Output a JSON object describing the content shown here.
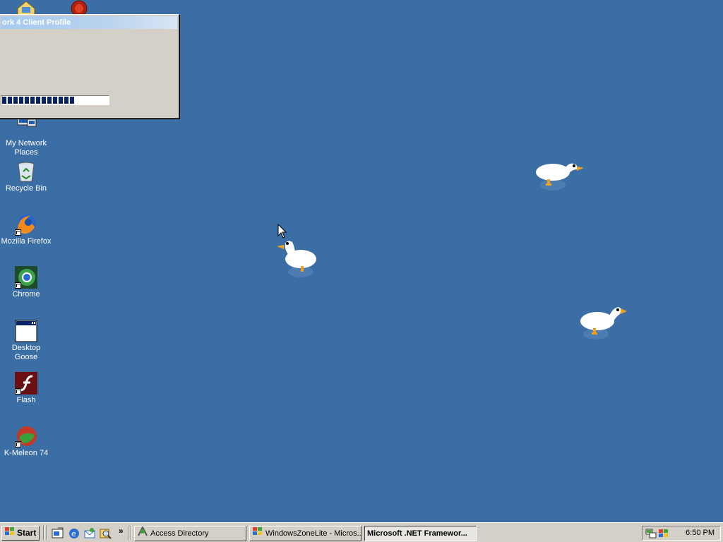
{
  "desktop": {
    "icons": [
      {
        "label": "My Network Places",
        "icon": "network-places-icon"
      },
      {
        "label": "Recycle Bin",
        "icon": "recycle-bin-icon"
      },
      {
        "label": "Mozilla Firefox",
        "icon": "firefox-icon"
      },
      {
        "label": "Chrome",
        "icon": "chrome-icon"
      },
      {
        "label": "Desktop Goose",
        "icon": "window-app-icon"
      },
      {
        "label": "Flash",
        "icon": "flash-icon"
      },
      {
        "label": "K-Meleon 74",
        "icon": "k-meleon-icon"
      }
    ],
    "background_color": "#3a6ea5"
  },
  "dialog": {
    "title": "ork 4 Client Profile",
    "progress": 0.7
  },
  "taskbar": {
    "start_label": "Start",
    "overflow_chevron": "»",
    "tasks": [
      {
        "label": "Access Directory",
        "icon": "network-connection-icon",
        "active": false
      },
      {
        "label": "WindowsZoneLite - Micros...",
        "icon": "windows-logo-icon",
        "active": false
      },
      {
        "label": "Microsoft .NET Framewor...",
        "icon": "",
        "active": true
      }
    ],
    "clock": "6:50 PM"
  }
}
